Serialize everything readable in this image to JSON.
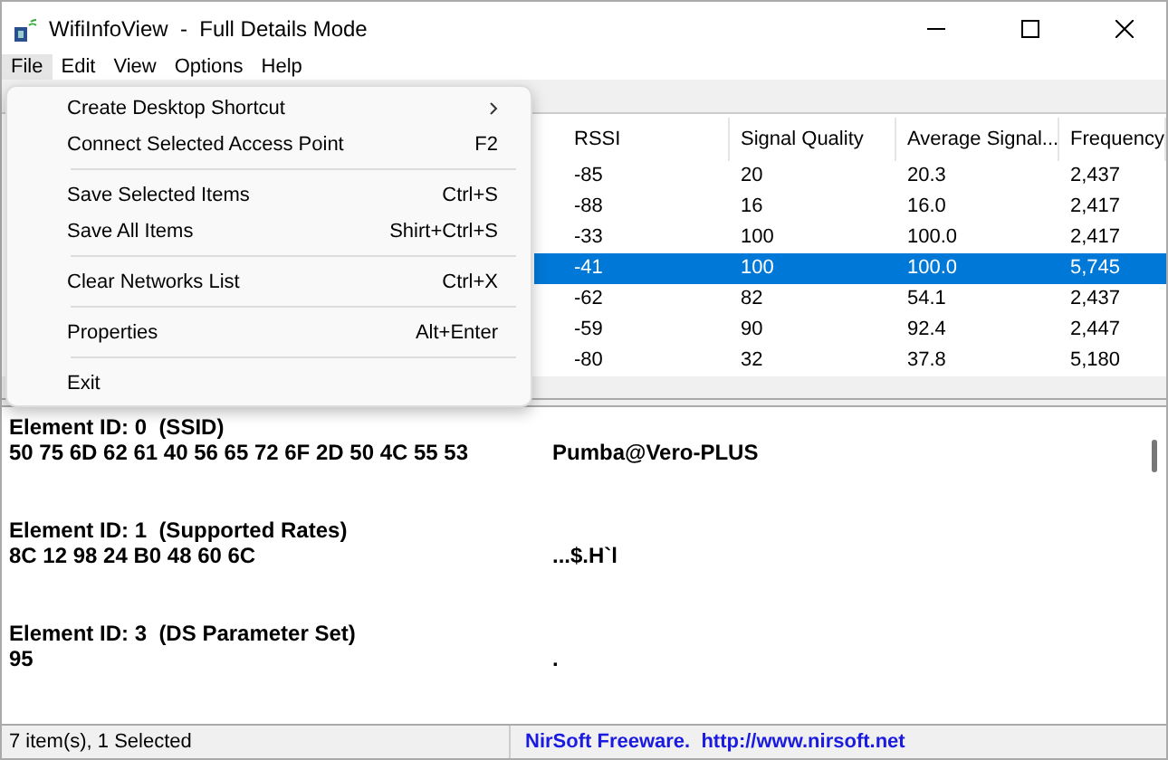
{
  "window": {
    "title": "WifiInfoView  -  Full Details Mode"
  },
  "menu_bar": [
    {
      "label": "File",
      "selected": true
    },
    {
      "label": "Edit",
      "selected": false
    },
    {
      "label": "View",
      "selected": false
    },
    {
      "label": "Options",
      "selected": false
    },
    {
      "label": "Help",
      "selected": false
    }
  ],
  "file_menu": [
    {
      "kind": "submenu",
      "label": "Create Desktop Shortcut"
    },
    {
      "kind": "item",
      "label": "Connect Selected Access Point",
      "shortcut": "F2"
    },
    {
      "kind": "separator"
    },
    {
      "kind": "item",
      "label": "Save Selected Items",
      "shortcut": "Ctrl+S"
    },
    {
      "kind": "item",
      "label": "Save All Items",
      "shortcut": "Shirt+Ctrl+S"
    },
    {
      "kind": "separator"
    },
    {
      "kind": "item",
      "label": "Clear Networks List",
      "shortcut": "Ctrl+X"
    },
    {
      "kind": "separator"
    },
    {
      "kind": "item",
      "label": "Properties",
      "shortcut": "Alt+Enter"
    },
    {
      "kind": "separator"
    },
    {
      "kind": "item",
      "label": "Exit"
    }
  ],
  "table": {
    "columns": [
      "RSSI",
      "Signal Quality",
      "Average Signal...",
      "Frequency"
    ],
    "rows": [
      {
        "cells": [
          "-85",
          "20",
          "20.3",
          "2,437"
        ],
        "selected": false
      },
      {
        "cells": [
          "-88",
          "16",
          "16.0",
          "2,417"
        ],
        "selected": false
      },
      {
        "cells": [
          "-33",
          "100",
          "100.0",
          "2,417"
        ],
        "selected": false
      },
      {
        "cells": [
          "-41",
          "100",
          "100.0",
          "5,745"
        ],
        "selected": true
      },
      {
        "cells": [
          "-62",
          "82",
          "54.1",
          "2,437"
        ],
        "selected": false
      },
      {
        "cells": [
          "-59",
          "90",
          "92.4",
          "2,447"
        ],
        "selected": false
      },
      {
        "cells": [
          "-80",
          "32",
          "37.8",
          "5,180"
        ],
        "selected": false
      }
    ]
  },
  "details": [
    {
      "heading": "Element ID: 0  (SSID)",
      "hex": "50 75 6D 62 61 40 56 65 72 6F 2D 50 4C 55 53",
      "ascii": "Pumba@Vero-PLUS"
    },
    {
      "heading": "Element ID: 1  (Supported Rates)",
      "hex": "8C 12 98 24 B0 48 60 6C",
      "ascii": "...$.H`l"
    },
    {
      "heading": "Element ID: 3  (DS Parameter Set)",
      "hex": "95",
      "ascii": "."
    }
  ],
  "status_bar": {
    "count": "7 item(s), 1 Selected",
    "credit": "NirSoft Freeware.  http://www.nirsoft.net"
  }
}
